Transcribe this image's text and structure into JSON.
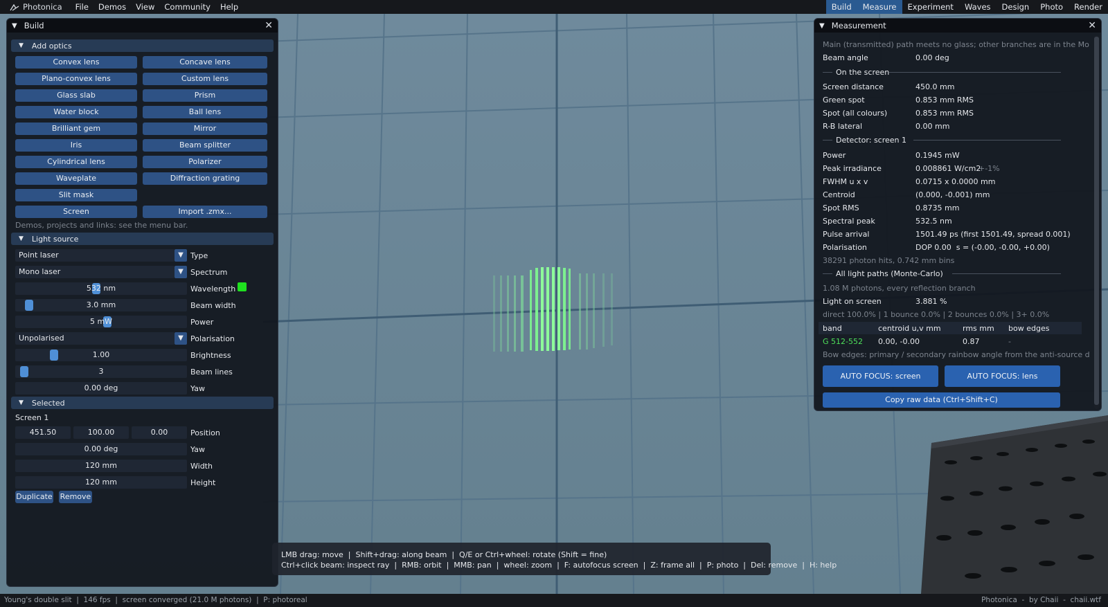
{
  "app": {
    "name": "Photonica"
  },
  "menu": {
    "items": [
      "File",
      "Demos",
      "View",
      "Community",
      "Help"
    ],
    "tabs": [
      {
        "label": "Build",
        "active": true
      },
      {
        "label": "Measure",
        "active": true
      },
      {
        "label": "Experiment",
        "active": false
      },
      {
        "label": "Waves",
        "active": false
      },
      {
        "label": "Design",
        "active": false
      },
      {
        "label": "Photo",
        "active": false
      },
      {
        "label": "Render",
        "active": false
      }
    ]
  },
  "build": {
    "title": "Build",
    "add_optics": {
      "label": "Add optics",
      "buttons": [
        "Convex lens",
        "Concave lens",
        "Plano-convex lens",
        "Custom lens",
        "Glass slab",
        "Prism",
        "Water block",
        "Ball lens",
        "Brilliant gem",
        "Mirror",
        "Iris",
        "Beam splitter",
        "Cylindrical lens",
        "Polarizer",
        "Waveplate",
        "Diffraction grating",
        "Slit mask",
        "Screen",
        "Import .zmx..."
      ],
      "note": "Demos, projects and links: see the menu bar."
    },
    "light_source": {
      "label": "Light source",
      "type": {
        "value": "Point laser",
        "label": "Type"
      },
      "spectrum": {
        "value": "Mono laser",
        "label": "Spectrum"
      },
      "wavelength": {
        "value": "532 nm",
        "label": "Wavelength",
        "color": "#1fe01f"
      },
      "beam_width": {
        "value": "3.0 mm",
        "label": "Beam width"
      },
      "power": {
        "value": "5 mW",
        "label": "Power"
      },
      "polarisation": {
        "value": "Unpolarised",
        "label": "Polarisation"
      },
      "brightness": {
        "value": "1.00",
        "label": "Brightness"
      },
      "beam_lines": {
        "value": "3",
        "label": "Beam lines"
      },
      "yaw": {
        "value": "0.00 deg",
        "label": "Yaw"
      }
    },
    "selected": {
      "label": "Selected",
      "name": "Screen 1",
      "position": {
        "x": "451.50",
        "y": "100.00",
        "z": "0.00",
        "label": "Position"
      },
      "yaw": {
        "value": "0.00 deg",
        "label": "Yaw"
      },
      "width": {
        "value": "120 mm",
        "label": "Width"
      },
      "height": {
        "value": "120 mm",
        "label": "Height"
      },
      "duplicate": "Duplicate",
      "remove": "Remove"
    }
  },
  "measurement": {
    "title": "Measurement",
    "note": "Main (transmitted) path meets no glass; other branches are in the Monte-",
    "beam_angle": {
      "label": "Beam angle",
      "value": "0.00 deg"
    },
    "on_screen": {
      "label": "On the screen",
      "rows": [
        {
          "label": "Screen distance",
          "value": "450.0 mm"
        },
        {
          "label": "Green spot",
          "value": "0.853 mm RMS"
        },
        {
          "label": "Spot (all colours)",
          "value": "0.853 mm RMS"
        },
        {
          "label": "R-B lateral",
          "value": "0.00 mm"
        }
      ]
    },
    "detector": {
      "label": "Detector: screen 1",
      "rows": [
        {
          "label": "Power",
          "value": "0.1945 mW",
          "extra": ""
        },
        {
          "label": "Peak irradiance",
          "value": "0.008861 W/cm2",
          "extra": "+-1%"
        },
        {
          "label": "FWHM u x v",
          "value": "0.0715 x 0.0000 mm",
          "extra": ""
        },
        {
          "label": "Centroid",
          "value": "(0.000, -0.001) mm",
          "extra": ""
        },
        {
          "label": "Spot RMS",
          "value": "0.8735 mm",
          "extra": ""
        },
        {
          "label": "Spectral peak",
          "value": "532.5 nm",
          "extra": ""
        },
        {
          "label": "Pulse arrival",
          "value": "1501.49 ps (first 1501.49, spread 0.001)",
          "extra": ""
        },
        {
          "label": "Polarisation",
          "value": "DOP 0.00  s = (-0.00, -0.00, +0.00)",
          "extra": ""
        }
      ],
      "hits": "38291 photon hits, 0.742 mm bins"
    },
    "all_paths": {
      "label": "All light paths (Monte-Carlo)",
      "photons": "1.08 M photons, every reflection branch",
      "light_on_screen": {
        "label": "Light on screen",
        "value": "3.881 %"
      },
      "bounces": "direct 100.0% | 1 bounce 0.0% | 2 bounces 0.0% | 3+ 0.0%",
      "table": {
        "headers": [
          "band",
          "centroid u,v mm",
          "rms mm",
          "bow edges"
        ],
        "rows": [
          [
            "G 512-552",
            "0.00, -0.00",
            "0.87",
            "-"
          ]
        ]
      },
      "bow_note": "Bow edges: primary / secondary rainbow angle from the anti-source direc"
    },
    "buttons": {
      "autofocus_screen": "AUTO FOCUS: screen",
      "autofocus_lens": "AUTO FOCUS: lens",
      "copy_raw": "Copy raw data (Ctrl+Shift+C)"
    }
  },
  "help": {
    "line1": "LMB drag: move  |  Shift+drag: along beam  |  Q/E or Ctrl+wheel: rotate (Shift = fine)",
    "line2": "Ctrl+click beam: inspect ray  |  RMB: orbit  |  MMB: pan  |  wheel: zoom  |  F: autofocus screen  |  Z: frame all  |  P: photo  |  Del: remove  |  H: help"
  },
  "status": {
    "left": "Young's double slit  |  146 fps  |  screen converged (21.0 M photons)  |  P: photoreal",
    "right": "Photonica  -  by Chaii  -  chaii.wtf"
  },
  "slider_levels": {
    "wavelength": 0.47,
    "beam_width": 0.06,
    "power": 0.54,
    "brightness": 0.21,
    "beam_lines": 0.03
  },
  "icons": [
    "photonica-logo-icon",
    "triangle-down-icon",
    "close-icon",
    "dropdown-arrow-icon"
  ],
  "colors": {
    "accent": "#2a5a91",
    "button": "#2e5285",
    "section": "#273b55",
    "swatch": "#1fe01f",
    "band_green": "#4ee05a"
  }
}
